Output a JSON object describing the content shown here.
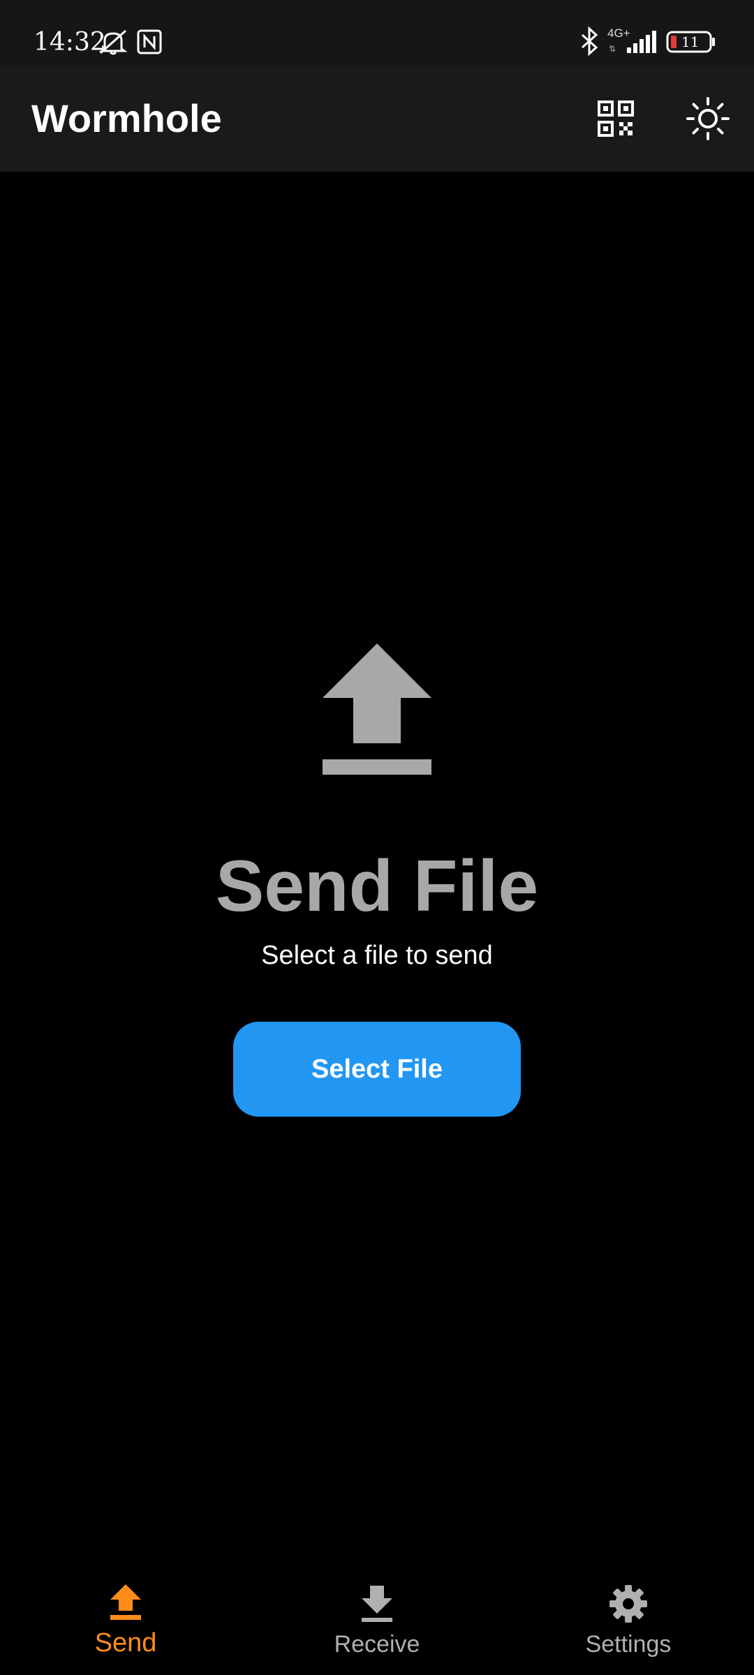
{
  "status_bar": {
    "time": "14:32",
    "network_label": "4G+",
    "battery_level": "11"
  },
  "app_bar": {
    "title": "Wormhole",
    "actions": [
      {
        "icon": "qr-code-icon"
      },
      {
        "icon": "brightness-icon"
      }
    ]
  },
  "main": {
    "hero_icon": "upload-icon",
    "title": "Send File",
    "subtitle": "Select a file to send",
    "button_label": "Select File"
  },
  "bottom_nav": {
    "items": [
      {
        "label": "Send",
        "icon": "upload-icon",
        "active": true
      },
      {
        "label": "Receive",
        "icon": "download-icon",
        "active": false
      },
      {
        "label": "Settings",
        "icon": "gear-icon",
        "active": false
      }
    ]
  },
  "colors": {
    "background": "#000000",
    "app_bar": "#1a1a1a",
    "status_bar": "#161616",
    "accent_active": "#ff8c1a",
    "button": "#2196f3",
    "hero_gray": "#a8a8a8",
    "inactive_gray": "#b0b0b0",
    "battery_low": "#e53935"
  }
}
